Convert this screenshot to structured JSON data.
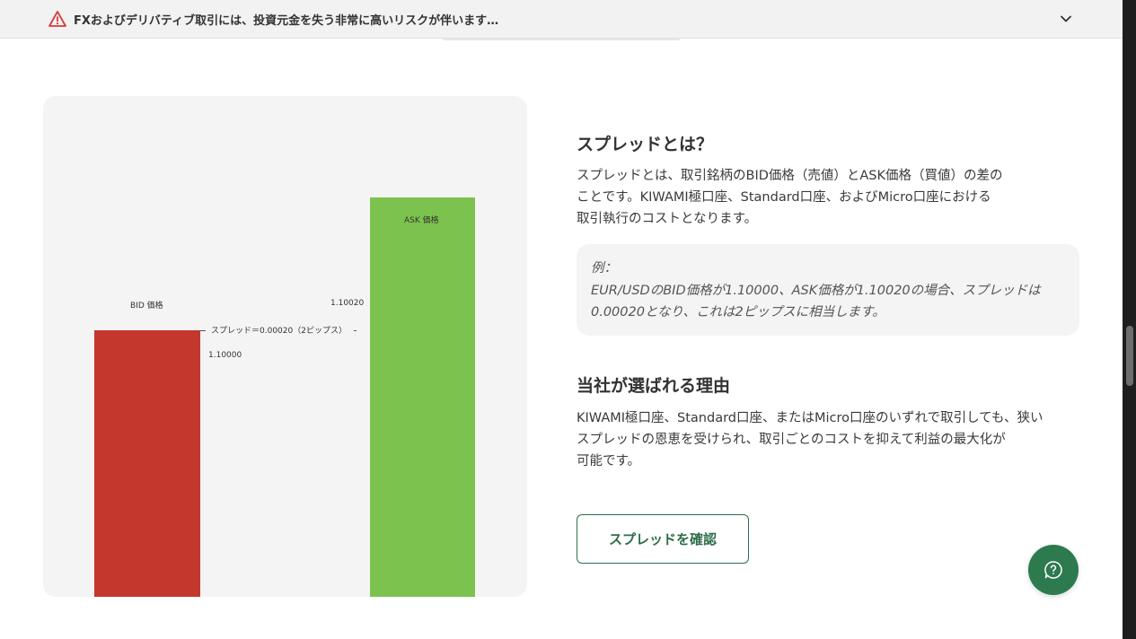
{
  "risk_bar": {
    "text": "FXおよびデリバティブ取引には、投資元金を失う非常に高いリスクが伴います…"
  },
  "colors": {
    "bid_bar": "#c4372d",
    "ask_bar": "#7cc24e",
    "accent": "#2d7a4f",
    "warning": "#d93a3a"
  },
  "chart_data": {
    "type": "bar",
    "categories": [
      "BID 価格",
      "ASK 価格"
    ],
    "values": [
      1.1,
      1.1002
    ],
    "value_labels": [
      "1.10000",
      "1.10020"
    ],
    "annotation": "スプレッド＝0.00020（2ピップス）"
  },
  "section1": {
    "title": "スプレッドとは？",
    "body_lines": [
      "スプレッドとは、取引銘柄のBID価格（売値）とASK価格（買値）の差の",
      "ことです。KIWAMI極口座、Standard口座、およびMicro口座における",
      "取引執行のコストとなります。"
    ]
  },
  "example": {
    "label": "例：",
    "lines": [
      "EUR/USDのBID価格が1.10000、ASK価格が1.10020の場合、スプレッドは",
      "0.00020となり、これは2ピップスに相当します。"
    ]
  },
  "section2": {
    "title": "当社が選ばれる理由",
    "body_lines": [
      "KIWAMI極口座、Standard口座、またはMicro口座のいずれで取引しても、狭い",
      "スプレッドの恩恵を受けられ、取引ごとのコストを抑えて利益の最大化が",
      "可能です。"
    ]
  },
  "cta": {
    "label": "スプレッドを確認"
  },
  "icons": {
    "warning": "warning-triangle-icon",
    "chevron": "chevron-down-icon",
    "help": "help-chat-icon"
  }
}
